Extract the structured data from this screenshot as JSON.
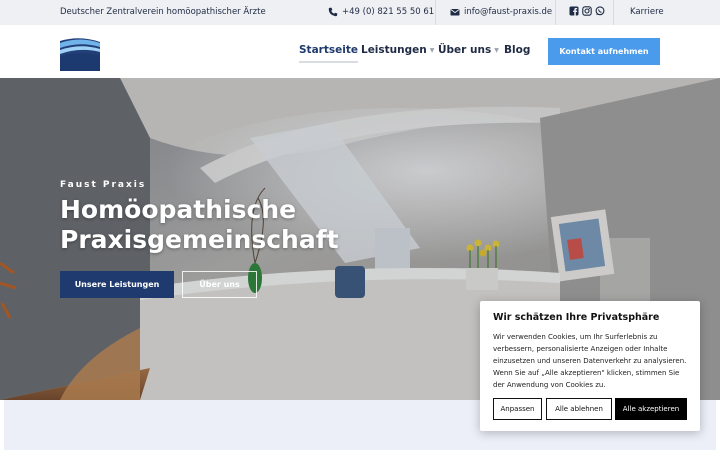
{
  "topbar": {
    "organization": "Deutscher Zentralverein homöopathischer Ärzte",
    "phone": "+49 (0) 821 55 50 61",
    "email": "info@faust-praxis.de",
    "career": "Karriere"
  },
  "nav": {
    "home": "Startseite",
    "services": "Leistungen",
    "about": "Über uns",
    "blog": "Blog",
    "contact_button": "Kontakt aufnehmen"
  },
  "hero": {
    "eyebrow": "Faust Praxis",
    "title": "Homöopathische Praxisgemeinschaft",
    "primary_button": "Unsere Leistungen",
    "secondary_button": "Über uns"
  },
  "cookie": {
    "title": "Wir schätzen Ihre Privatsphäre",
    "text": "Wir verwenden Cookies, um Ihr Surferlebnis zu verbessern, personalisierte Anzeigen oder Inhalte einzusetzen und unseren Datenverkehr zu analysieren. Wenn Sie auf „Alle akzeptieren\" klicken, stimmen Sie der Anwendung von Cookies zu.",
    "adjust": "Anpassen",
    "reject": "Alle ablehnen",
    "accept": "Alle akzeptieren"
  },
  "icons": [
    "phone-icon",
    "envelope-icon",
    "facebook-icon",
    "instagram-icon",
    "whatsapp-icon",
    "caret-down-icon"
  ],
  "colors": {
    "brand_dark": "#1f3a6e",
    "accent": "#4a9bec",
    "topbar_bg": "#eef0f3"
  }
}
